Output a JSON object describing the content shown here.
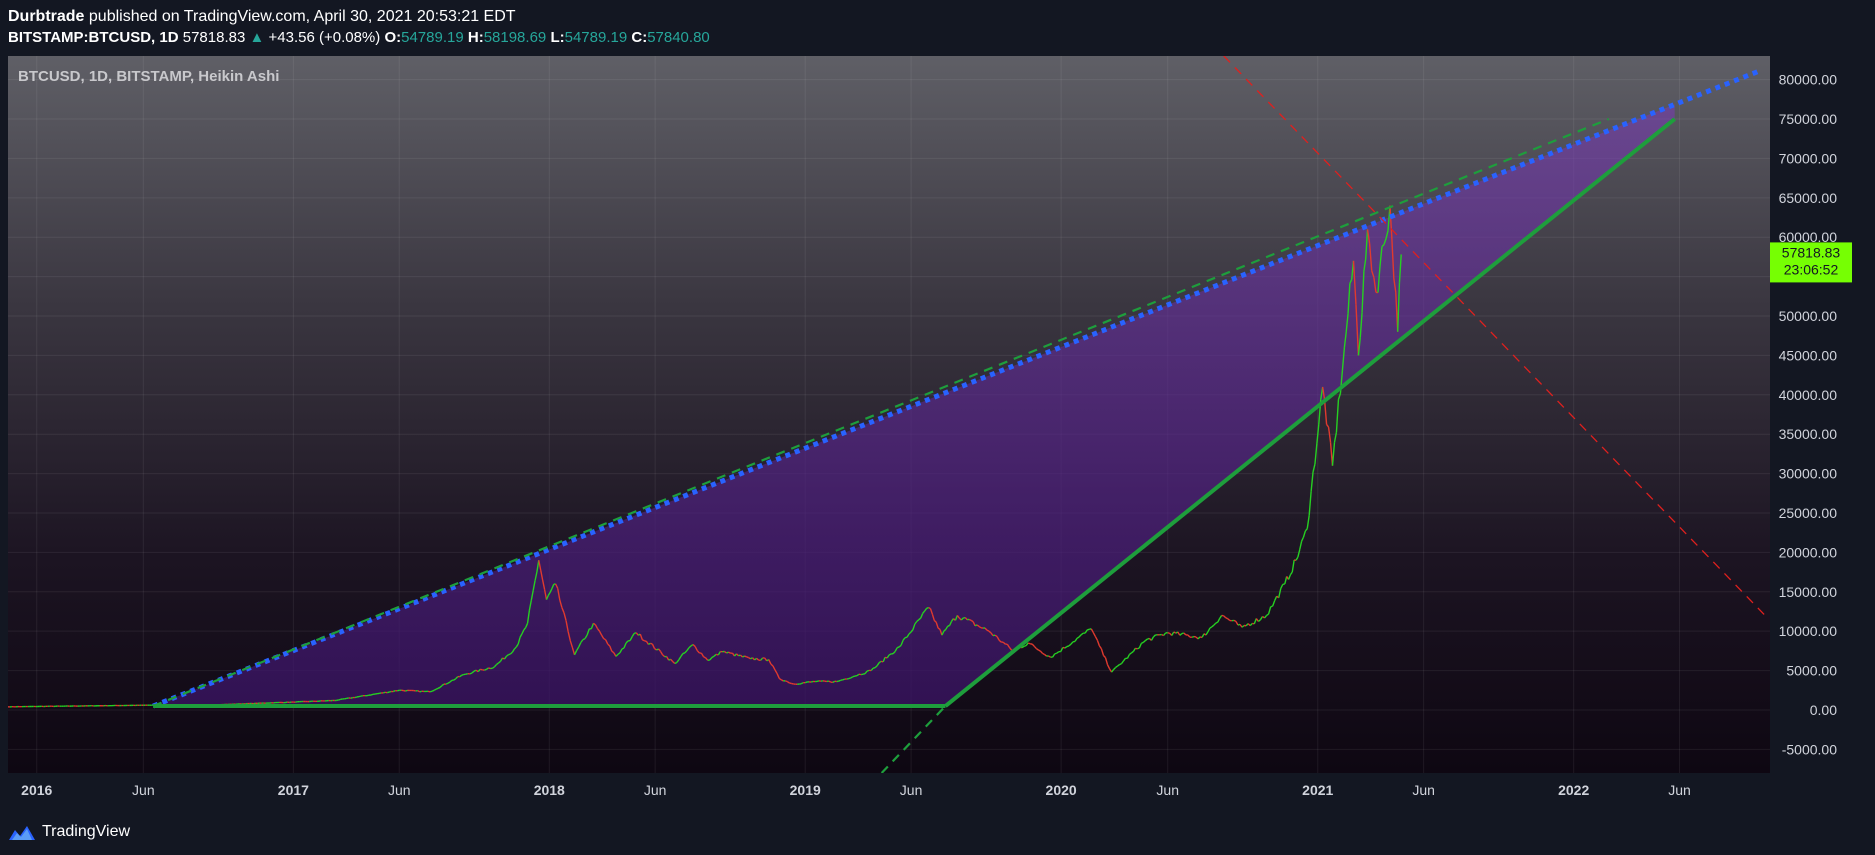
{
  "header": {
    "author": "Durbtrade",
    "published": "published on TradingView.com, April 30, 2021 20:53:21 EDT",
    "symbol": "BITSTAMP:BTCUSD, 1D",
    "last": "57818.83",
    "change": "+43.56 (+0.08%)",
    "o_label": "O:",
    "o_value": "54789.19",
    "h_label": "H:",
    "h_value": "58198.69",
    "l_label": "L:",
    "l_value": "54789.19",
    "c_label": "C:",
    "c_value": "57840.80"
  },
  "chart_data": {
    "type": "line",
    "title": "BTCUSD, 1D, BITSTAMP, Heikin Ashi",
    "chart_style": "heikin-ashi candlesticks",
    "xlim": [
      "2015-11-21",
      "2022-10-08"
    ],
    "ylim": [
      -8000,
      83000
    ],
    "grid": true,
    "x_ticks": [
      {
        "date": "2016-01-01",
        "label": "2016",
        "major": true
      },
      {
        "date": "2016-06-01",
        "label": "Jun",
        "major": false
      },
      {
        "date": "2017-01-01",
        "label": "2017",
        "major": true
      },
      {
        "date": "2017-06-01",
        "label": "Jun",
        "major": false
      },
      {
        "date": "2018-01-01",
        "label": "2018",
        "major": true
      },
      {
        "date": "2018-06-01",
        "label": "Jun",
        "major": false
      },
      {
        "date": "2019-01-01",
        "label": "2019",
        "major": true
      },
      {
        "date": "2019-06-01",
        "label": "Jun",
        "major": false
      },
      {
        "date": "2020-01-01",
        "label": "2020",
        "major": true
      },
      {
        "date": "2020-06-01",
        "label": "Jun",
        "major": false
      },
      {
        "date": "2021-01-01",
        "label": "2021",
        "major": true
      },
      {
        "date": "2021-06-01",
        "label": "Jun",
        "major": false
      },
      {
        "date": "2022-01-01",
        "label": "2022",
        "major": true
      },
      {
        "date": "2022-06-01",
        "label": "Jun",
        "major": false
      }
    ],
    "y_ticks": [
      {
        "v": 80000,
        "label": "80000.00"
      },
      {
        "v": 75000,
        "label": "75000.00"
      },
      {
        "v": 70000,
        "label": "70000.00"
      },
      {
        "v": 65000,
        "label": "65000.00"
      },
      {
        "v": 60000,
        "label": "60000.00"
      },
      {
        "v": 55000,
        "label": "55000.00"
      },
      {
        "v": 50000,
        "label": "50000.00"
      },
      {
        "v": 45000,
        "label": "45000.00"
      },
      {
        "v": 40000,
        "label": "40000.00"
      },
      {
        "v": 35000,
        "label": "35000.00"
      },
      {
        "v": 30000,
        "label": "30000.00"
      },
      {
        "v": 25000,
        "label": "25000.00"
      },
      {
        "v": 20000,
        "label": "20000.00"
      },
      {
        "v": 15000,
        "label": "15000.00"
      },
      {
        "v": 10000,
        "label": "10000.00"
      },
      {
        "v": 5000,
        "label": "5000.00"
      },
      {
        "v": 0,
        "label": "0.00"
      },
      {
        "v": -5000,
        "label": "-5000.00"
      }
    ],
    "price_line": [
      [
        "2015-11-21",
        400
      ],
      [
        "2016-06-01",
        600
      ],
      [
        "2016-09-01",
        620
      ],
      [
        "2017-01-01",
        1000
      ],
      [
        "2017-03-01",
        1200
      ],
      [
        "2017-06-01",
        2500
      ],
      [
        "2017-07-15",
        2300
      ],
      [
        "2017-09-01",
        4500
      ],
      [
        "2017-10-15",
        5500
      ],
      [
        "2017-11-15",
        8000
      ],
      [
        "2017-12-01",
        11000
      ],
      [
        "2017-12-17",
        19000
      ],
      [
        "2017-12-28",
        14000
      ],
      [
        "2018-01-10",
        16000
      ],
      [
        "2018-02-06",
        7000
      ],
      [
        "2018-03-05",
        11000
      ],
      [
        "2018-04-06",
        6800
      ],
      [
        "2018-05-05",
        9800
      ],
      [
        "2018-06-29",
        5900
      ],
      [
        "2018-07-25",
        8300
      ],
      [
        "2018-08-15",
        6300
      ],
      [
        "2018-09-05",
        7400
      ],
      [
        "2018-10-15",
        6500
      ],
      [
        "2018-11-10",
        6400
      ],
      [
        "2018-11-25",
        4000
      ],
      [
        "2018-12-15",
        3300
      ],
      [
        "2019-01-15",
        3600
      ],
      [
        "2019-02-15",
        3600
      ],
      [
        "2019-04-05",
        5000
      ],
      [
        "2019-05-15",
        8000
      ],
      [
        "2019-06-26",
        13000
      ],
      [
        "2019-07-15",
        9500
      ],
      [
        "2019-08-06",
        12000
      ],
      [
        "2019-09-20",
        10000
      ],
      [
        "2019-10-25",
        7500
      ],
      [
        "2019-11-15",
        8500
      ],
      [
        "2019-12-17",
        6700
      ],
      [
        "2020-02-13",
        10300
      ],
      [
        "2020-03-13",
        4800
      ],
      [
        "2020-04-30",
        8800
      ],
      [
        "2020-06-01",
        9800
      ],
      [
        "2020-07-20",
        9200
      ],
      [
        "2020-08-17",
        12000
      ],
      [
        "2020-09-15",
        10500
      ],
      [
        "2020-10-20",
        12000
      ],
      [
        "2020-11-15",
        16000
      ],
      [
        "2020-12-01",
        19000
      ],
      [
        "2020-12-17",
        23000
      ],
      [
        "2021-01-08",
        41000
      ],
      [
        "2021-01-22",
        31000
      ],
      [
        "2021-02-08",
        46000
      ],
      [
        "2021-02-21",
        57000
      ],
      [
        "2021-02-28",
        45000
      ],
      [
        "2021-03-13",
        61000
      ],
      [
        "2021-03-25",
        53000
      ],
      [
        "2021-04-14",
        64000
      ],
      [
        "2021-04-25",
        48000
      ],
      [
        "2021-04-30",
        57818.83
      ]
    ],
    "drawings": [
      {
        "type": "trendline",
        "style": "dotted",
        "color": "#2962ff",
        "from": [
          "2016-06-15",
          500
        ],
        "to": [
          "2022-09-20",
          81000
        ]
      },
      {
        "type": "trendline",
        "style": "dashed",
        "color": "#1e9e3c",
        "from": [
          "2016-06-15",
          500
        ],
        "to": [
          "2022-02-20",
          75000
        ]
      },
      {
        "type": "trendline",
        "style": "solid",
        "color": "#1e9e3c",
        "from": [
          "2016-06-15",
          500
        ],
        "to": [
          "2019-07-20",
          500
        ]
      },
      {
        "type": "trendline",
        "style": "solid",
        "color": "#1e9e3c",
        "from": [
          "2019-07-20",
          500
        ],
        "to": [
          "2022-05-25",
          75000
        ]
      },
      {
        "type": "trendline",
        "style": "dashed",
        "color": "#1e9e3c",
        "from": [
          "2019-04-20",
          -8000
        ],
        "to": [
          "2019-07-20",
          500
        ]
      },
      {
        "type": "trendline",
        "style": "dashed",
        "color": "#e0201e",
        "from": [
          "2020-08-20",
          83000
        ],
        "to": [
          "2022-10-01",
          12000
        ]
      }
    ],
    "last_price_label": "57818.83",
    "countdown_label": "23:06:52"
  },
  "footer": {
    "brand": "TradingView",
    "logo_icon": "tradingview-logo-icon"
  },
  "colors": {
    "background": "#131722",
    "candle_up": "#26d022",
    "candle_down": "#e03a2e",
    "fill": "#5a2d96",
    "price_label_bg": "#76ff03"
  }
}
